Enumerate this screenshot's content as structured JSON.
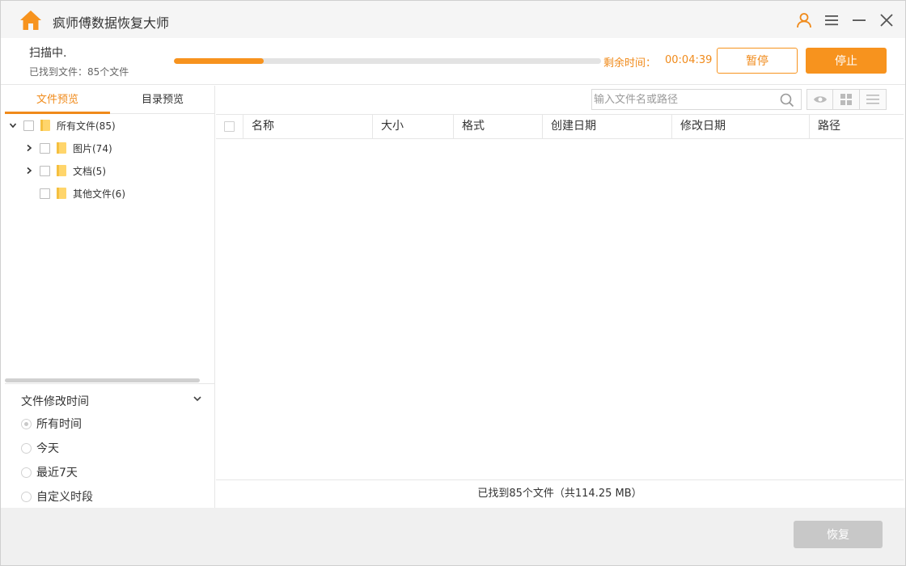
{
  "app": {
    "title": "疯师傅数据恢复大师",
    "accent_color": "#f7931e",
    "icons": [
      "home-icon",
      "user-icon",
      "menu-icon",
      "minimize-icon",
      "close-icon"
    ]
  },
  "scan": {
    "status": "扫描中.",
    "found_text": "已找到文件：85个文件",
    "progress_percent": 21,
    "remaining_label": "剩余时间：",
    "remaining_value": "00:04:39",
    "pause_label": "暂停",
    "stop_label": "停止"
  },
  "left_panel": {
    "tabs": [
      {
        "label": "文件预览",
        "active": true
      },
      {
        "label": "目录预览",
        "active": false
      }
    ],
    "tree": [
      {
        "label": "所有文件(85)",
        "level": 0,
        "expanded": true
      },
      {
        "label": "图片(74)",
        "level": 1,
        "expandable": true
      },
      {
        "label": "文档(5)",
        "level": 1,
        "expandable": true
      },
      {
        "label": "其他文件(6)",
        "level": 1,
        "expandable": false
      }
    ],
    "filter": {
      "title": "文件修改时间",
      "options": [
        {
          "label": "所有时间",
          "selected": true
        },
        {
          "label": "今天",
          "selected": false
        },
        {
          "label": "最近7天",
          "selected": false
        },
        {
          "label": "自定义时段",
          "selected": false
        }
      ]
    }
  },
  "right_panel": {
    "search_placeholder": "输入文件名或路径",
    "view_icons": [
      "eye-icon",
      "grid-icon",
      "list-icon"
    ],
    "columns": [
      "名称",
      "大小",
      "格式",
      "创建日期",
      "修改日期",
      "路径"
    ],
    "footer": "已找到85个文件（共114.25 MB）"
  },
  "bottom": {
    "recover_label": "恢复"
  }
}
